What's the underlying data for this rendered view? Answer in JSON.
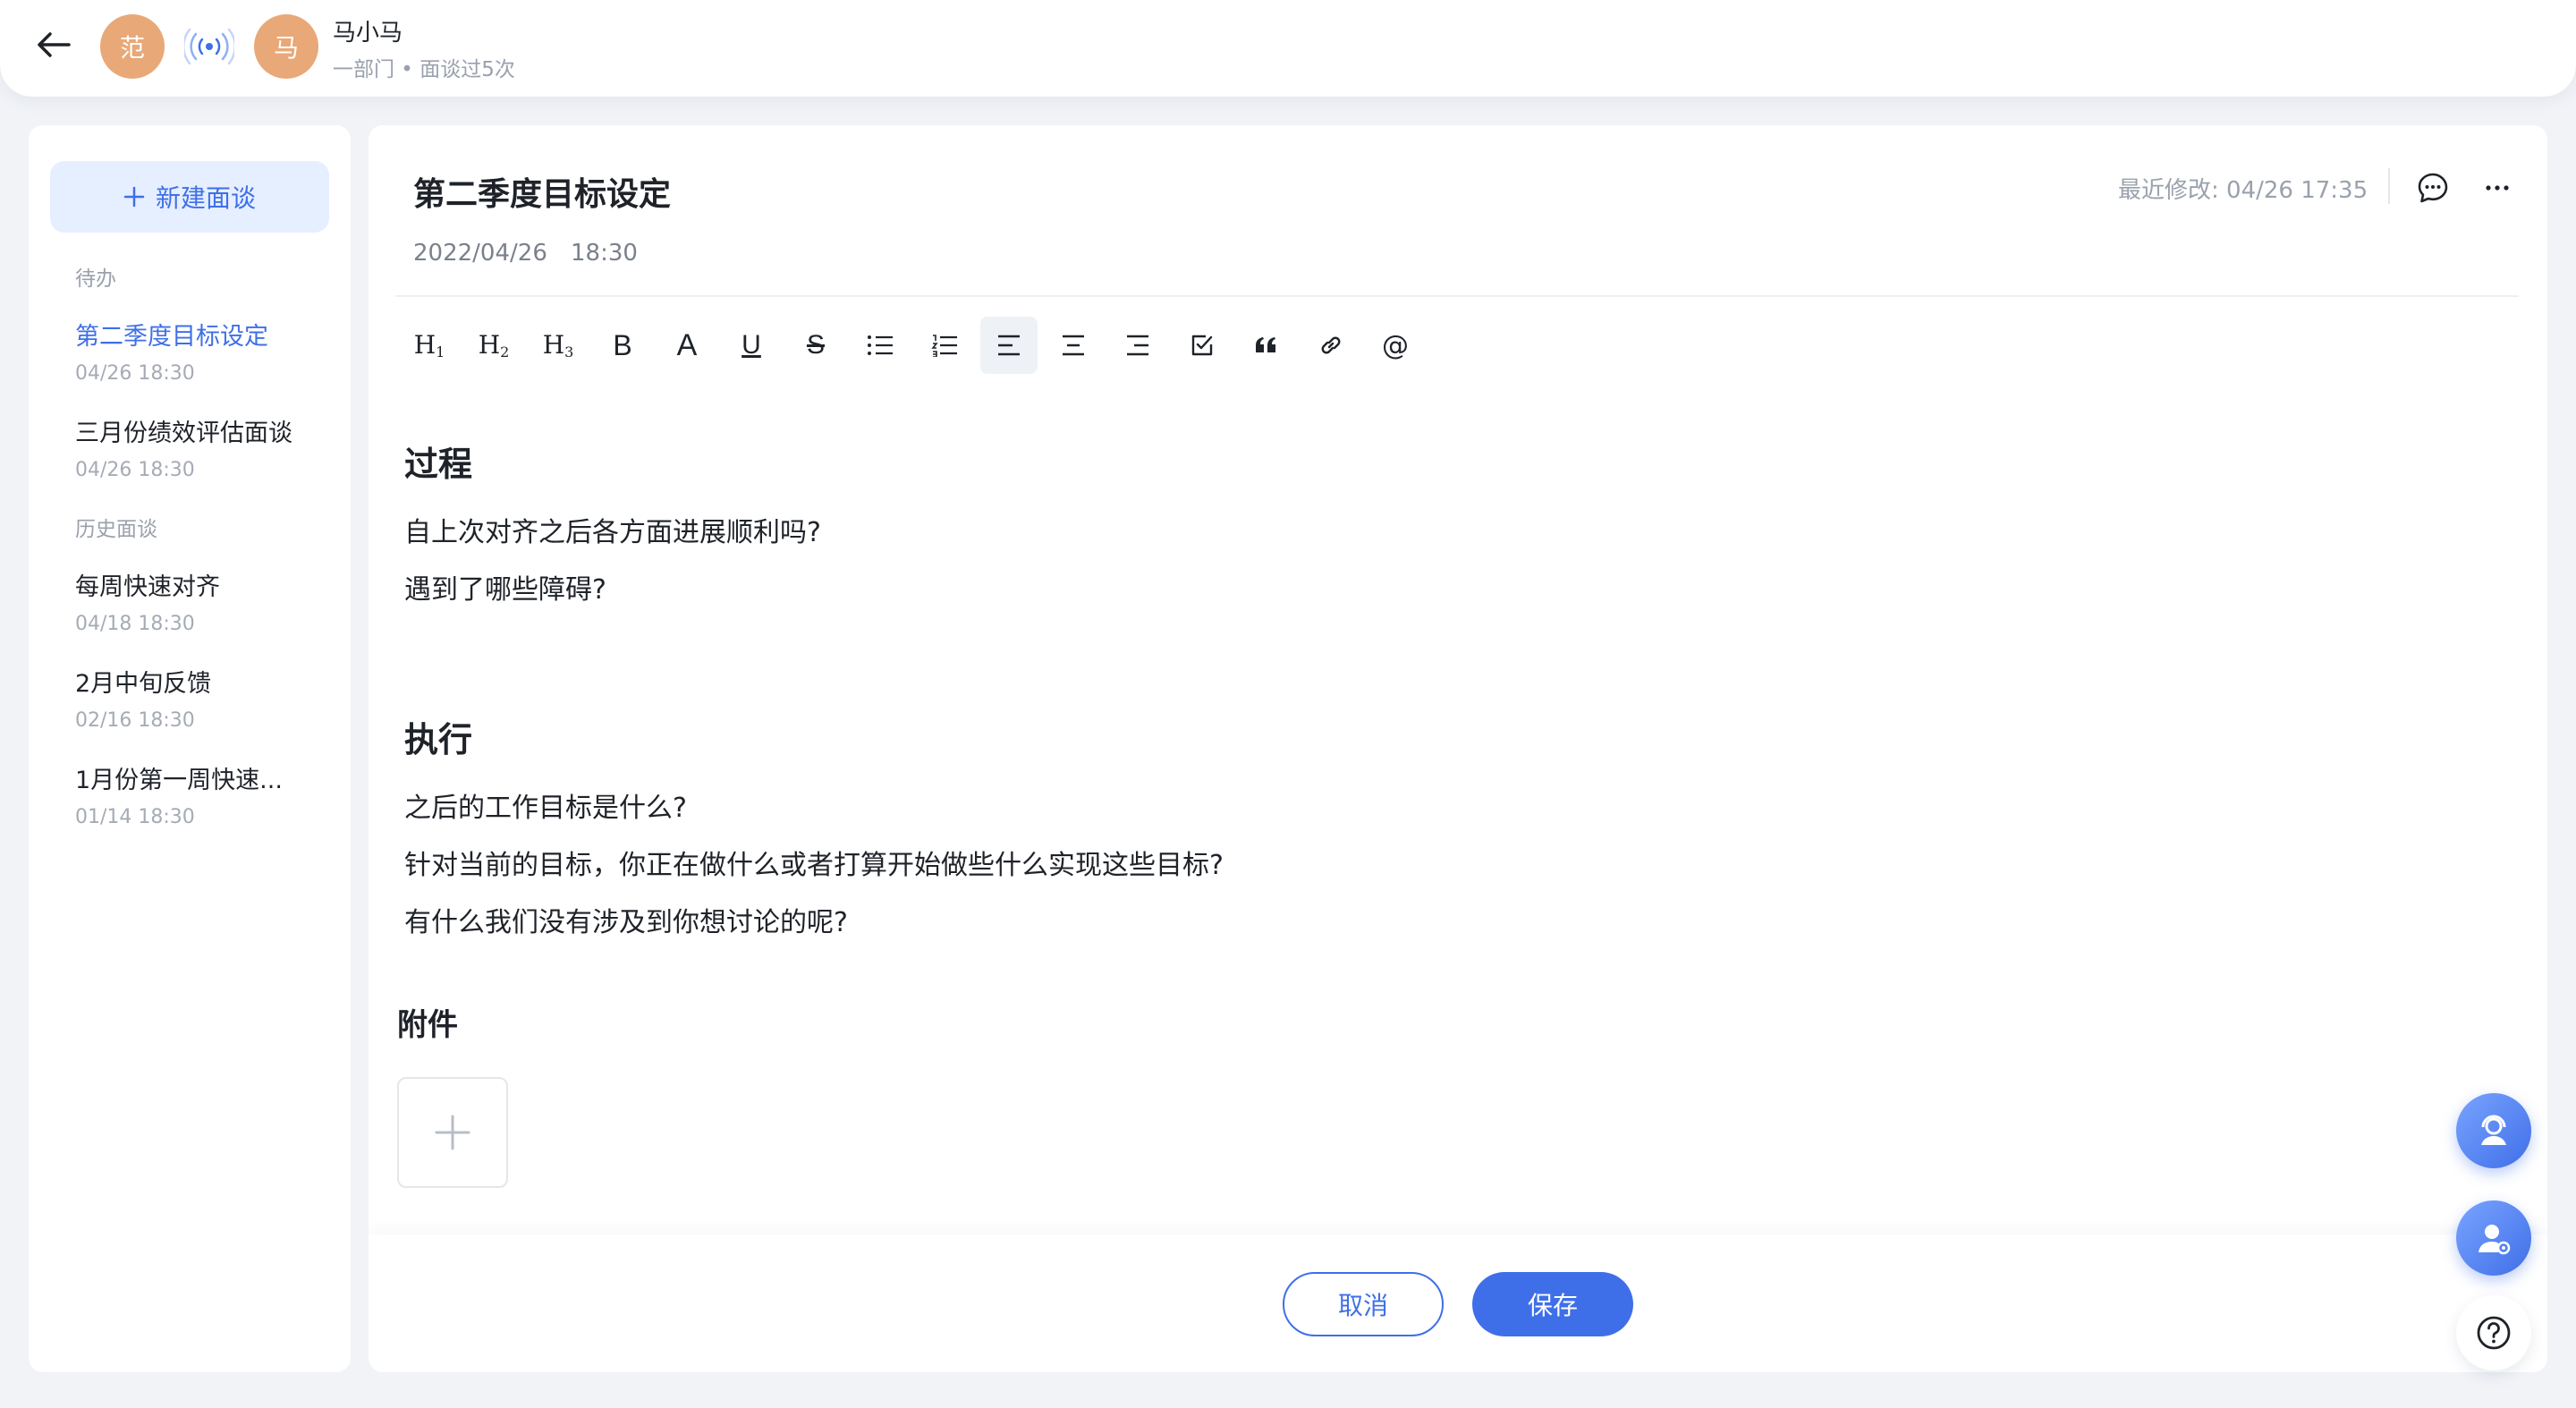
{
  "header": {
    "avatar_1": "范",
    "avatar_2": "马",
    "user_name": "马小马",
    "user_meta": "一部门 • 面谈过5次"
  },
  "sidebar": {
    "new_button": "新建面谈",
    "section_todo": "待办",
    "section_history": "历史面谈",
    "todo_items": [
      {
        "title": "第二季度目标设定",
        "date": "04/26 18:30",
        "active": true
      },
      {
        "title": "三月份绩效评估面谈",
        "date": "04/26 18:30"
      }
    ],
    "history_items": [
      {
        "title": "每周快速对齐",
        "date": "04/18 18:30"
      },
      {
        "title": "2月中旬反馈",
        "date": "02/16 18:30"
      },
      {
        "title": "1月份第一周快速...",
        "date": "01/14 18:30"
      }
    ]
  },
  "document": {
    "title": "第二季度目标设定",
    "date": "2022/04/26",
    "time": "18:30",
    "last_modified": "最近修改: 04/26 17:35",
    "toolbar": [
      "h1",
      "h2",
      "h3",
      "bold",
      "font-color",
      "underline",
      "strikethrough",
      "bulleted-list",
      "numbered-list",
      "align-left",
      "align-center",
      "align-right",
      "checkbox",
      "quote",
      "link",
      "mention"
    ],
    "sections": [
      {
        "heading": "过程",
        "lines": [
          "自上次对齐之后各方面进展顺利吗?",
          "遇到了哪些障碍?"
        ]
      },
      {
        "heading": "执行",
        "lines": [
          "之后的工作目标是什么?",
          "针对当前的目标，你正在做什么或者打算开始做些什么实现这些目标?",
          "有什么我们没有涉及到你想讨论的呢?"
        ]
      }
    ],
    "attachments_title": "附件"
  },
  "footer": {
    "cancel_label": "取消",
    "save_label": "保存"
  },
  "colors": {
    "accent": "#3f6fe8",
    "avatar": "#e9a877",
    "background": "#f1f3f7"
  }
}
